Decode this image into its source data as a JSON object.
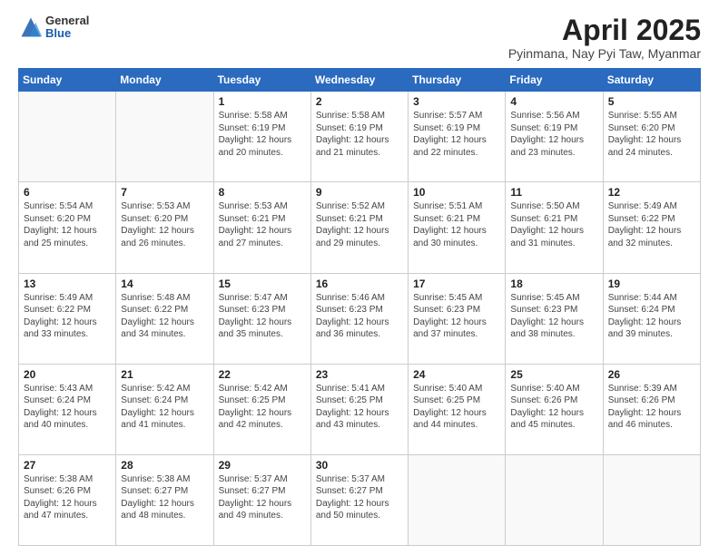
{
  "logo": {
    "general": "General",
    "blue": "Blue"
  },
  "header": {
    "title": "April 2025",
    "location": "Pyinmana, Nay Pyi Taw, Myanmar"
  },
  "weekdays": [
    "Sunday",
    "Monday",
    "Tuesday",
    "Wednesday",
    "Thursday",
    "Friday",
    "Saturday"
  ],
  "weeks": [
    [
      {
        "day": "",
        "sunrise": "",
        "sunset": "",
        "daylight": ""
      },
      {
        "day": "",
        "sunrise": "",
        "sunset": "",
        "daylight": ""
      },
      {
        "day": "1",
        "sunrise": "Sunrise: 5:58 AM",
        "sunset": "Sunset: 6:19 PM",
        "daylight": "Daylight: 12 hours and 20 minutes."
      },
      {
        "day": "2",
        "sunrise": "Sunrise: 5:58 AM",
        "sunset": "Sunset: 6:19 PM",
        "daylight": "Daylight: 12 hours and 21 minutes."
      },
      {
        "day": "3",
        "sunrise": "Sunrise: 5:57 AM",
        "sunset": "Sunset: 6:19 PM",
        "daylight": "Daylight: 12 hours and 22 minutes."
      },
      {
        "day": "4",
        "sunrise": "Sunrise: 5:56 AM",
        "sunset": "Sunset: 6:19 PM",
        "daylight": "Daylight: 12 hours and 23 minutes."
      },
      {
        "day": "5",
        "sunrise": "Sunrise: 5:55 AM",
        "sunset": "Sunset: 6:20 PM",
        "daylight": "Daylight: 12 hours and 24 minutes."
      }
    ],
    [
      {
        "day": "6",
        "sunrise": "Sunrise: 5:54 AM",
        "sunset": "Sunset: 6:20 PM",
        "daylight": "Daylight: 12 hours and 25 minutes."
      },
      {
        "day": "7",
        "sunrise": "Sunrise: 5:53 AM",
        "sunset": "Sunset: 6:20 PM",
        "daylight": "Daylight: 12 hours and 26 minutes."
      },
      {
        "day": "8",
        "sunrise": "Sunrise: 5:53 AM",
        "sunset": "Sunset: 6:21 PM",
        "daylight": "Daylight: 12 hours and 27 minutes."
      },
      {
        "day": "9",
        "sunrise": "Sunrise: 5:52 AM",
        "sunset": "Sunset: 6:21 PM",
        "daylight": "Daylight: 12 hours and 29 minutes."
      },
      {
        "day": "10",
        "sunrise": "Sunrise: 5:51 AM",
        "sunset": "Sunset: 6:21 PM",
        "daylight": "Daylight: 12 hours and 30 minutes."
      },
      {
        "day": "11",
        "sunrise": "Sunrise: 5:50 AM",
        "sunset": "Sunset: 6:21 PM",
        "daylight": "Daylight: 12 hours and 31 minutes."
      },
      {
        "day": "12",
        "sunrise": "Sunrise: 5:49 AM",
        "sunset": "Sunset: 6:22 PM",
        "daylight": "Daylight: 12 hours and 32 minutes."
      }
    ],
    [
      {
        "day": "13",
        "sunrise": "Sunrise: 5:49 AM",
        "sunset": "Sunset: 6:22 PM",
        "daylight": "Daylight: 12 hours and 33 minutes."
      },
      {
        "day": "14",
        "sunrise": "Sunrise: 5:48 AM",
        "sunset": "Sunset: 6:22 PM",
        "daylight": "Daylight: 12 hours and 34 minutes."
      },
      {
        "day": "15",
        "sunrise": "Sunrise: 5:47 AM",
        "sunset": "Sunset: 6:23 PM",
        "daylight": "Daylight: 12 hours and 35 minutes."
      },
      {
        "day": "16",
        "sunrise": "Sunrise: 5:46 AM",
        "sunset": "Sunset: 6:23 PM",
        "daylight": "Daylight: 12 hours and 36 minutes."
      },
      {
        "day": "17",
        "sunrise": "Sunrise: 5:45 AM",
        "sunset": "Sunset: 6:23 PM",
        "daylight": "Daylight: 12 hours and 37 minutes."
      },
      {
        "day": "18",
        "sunrise": "Sunrise: 5:45 AM",
        "sunset": "Sunset: 6:23 PM",
        "daylight": "Daylight: 12 hours and 38 minutes."
      },
      {
        "day": "19",
        "sunrise": "Sunrise: 5:44 AM",
        "sunset": "Sunset: 6:24 PM",
        "daylight": "Daylight: 12 hours and 39 minutes."
      }
    ],
    [
      {
        "day": "20",
        "sunrise": "Sunrise: 5:43 AM",
        "sunset": "Sunset: 6:24 PM",
        "daylight": "Daylight: 12 hours and 40 minutes."
      },
      {
        "day": "21",
        "sunrise": "Sunrise: 5:42 AM",
        "sunset": "Sunset: 6:24 PM",
        "daylight": "Daylight: 12 hours and 41 minutes."
      },
      {
        "day": "22",
        "sunrise": "Sunrise: 5:42 AM",
        "sunset": "Sunset: 6:25 PM",
        "daylight": "Daylight: 12 hours and 42 minutes."
      },
      {
        "day": "23",
        "sunrise": "Sunrise: 5:41 AM",
        "sunset": "Sunset: 6:25 PM",
        "daylight": "Daylight: 12 hours and 43 minutes."
      },
      {
        "day": "24",
        "sunrise": "Sunrise: 5:40 AM",
        "sunset": "Sunset: 6:25 PM",
        "daylight": "Daylight: 12 hours and 44 minutes."
      },
      {
        "day": "25",
        "sunrise": "Sunrise: 5:40 AM",
        "sunset": "Sunset: 6:26 PM",
        "daylight": "Daylight: 12 hours and 45 minutes."
      },
      {
        "day": "26",
        "sunrise": "Sunrise: 5:39 AM",
        "sunset": "Sunset: 6:26 PM",
        "daylight": "Daylight: 12 hours and 46 minutes."
      }
    ],
    [
      {
        "day": "27",
        "sunrise": "Sunrise: 5:38 AM",
        "sunset": "Sunset: 6:26 PM",
        "daylight": "Daylight: 12 hours and 47 minutes."
      },
      {
        "day": "28",
        "sunrise": "Sunrise: 5:38 AM",
        "sunset": "Sunset: 6:27 PM",
        "daylight": "Daylight: 12 hours and 48 minutes."
      },
      {
        "day": "29",
        "sunrise": "Sunrise: 5:37 AM",
        "sunset": "Sunset: 6:27 PM",
        "daylight": "Daylight: 12 hours and 49 minutes."
      },
      {
        "day": "30",
        "sunrise": "Sunrise: 5:37 AM",
        "sunset": "Sunset: 6:27 PM",
        "daylight": "Daylight: 12 hours and 50 minutes."
      },
      {
        "day": "",
        "sunrise": "",
        "sunset": "",
        "daylight": ""
      },
      {
        "day": "",
        "sunrise": "",
        "sunset": "",
        "daylight": ""
      },
      {
        "day": "",
        "sunrise": "",
        "sunset": "",
        "daylight": ""
      }
    ]
  ]
}
